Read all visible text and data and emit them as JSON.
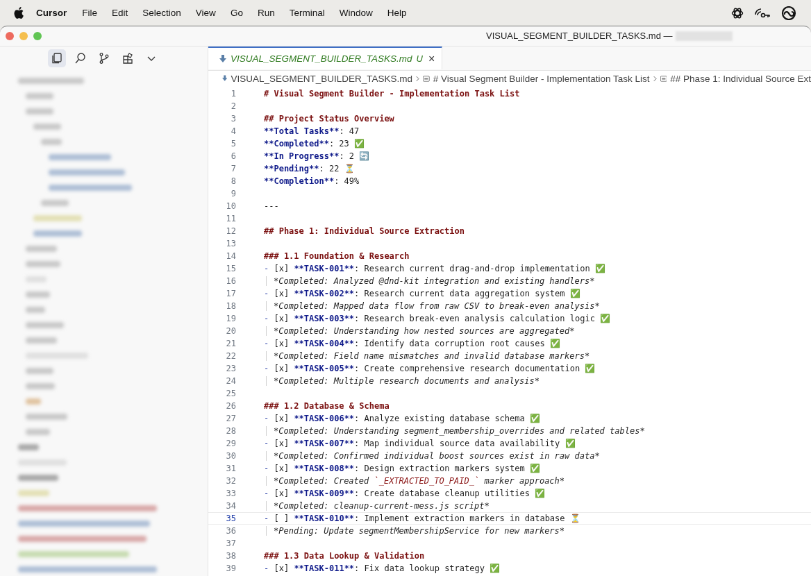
{
  "menu_bar": {
    "app": "Cursor",
    "items": [
      "File",
      "Edit",
      "Selection",
      "View",
      "Go",
      "Run",
      "Terminal",
      "Window",
      "Help"
    ]
  },
  "window": {
    "title": "VISUAL_SEGMENT_BUILDER_TASKS.md —"
  },
  "activity_bar": [
    {
      "selected": true
    },
    {
      "selected": false
    },
    {
      "selected": false
    },
    {
      "selected": false
    },
    {
      "selected": false
    }
  ],
  "tab": {
    "label": "VISUAL_SEGMENT_BUILDER_TASKS.md",
    "status": "U",
    "close": "×"
  },
  "breadcrumbs": [
    "VISUAL_SEGMENT_BUILDER_TASKS.md",
    "# Visual Segment Builder - Implementation Task List",
    "## Phase 1: Individual Source Ext"
  ],
  "lines": [
    {
      "n": "1",
      "current": false,
      "kind": "h",
      "text": "# Visual Segment Builder - Implementation Task List"
    },
    {
      "n": "2",
      "current": false,
      "kind": "blank"
    },
    {
      "n": "3",
      "current": false,
      "kind": "h",
      "text": "## Project Status Overview"
    },
    {
      "n": "4",
      "current": false,
      "kind": "field",
      "label": "**Total Tasks**",
      "value": ": 47"
    },
    {
      "n": "5",
      "current": false,
      "kind": "field",
      "label": "**Completed**",
      "value": ": 23",
      "emoji": "✅"
    },
    {
      "n": "6",
      "current": false,
      "kind": "field",
      "label": "**In Progress**",
      "value": ": 2",
      "emoji": "🔄"
    },
    {
      "n": "7",
      "current": false,
      "kind": "field",
      "label": "**Pending**",
      "value": ": 22",
      "emoji": "⏳"
    },
    {
      "n": "8",
      "current": false,
      "kind": "field",
      "label": "**Completion**",
      "value": ": 49%"
    },
    {
      "n": "9",
      "current": false,
      "kind": "blank"
    },
    {
      "n": "10",
      "current": false,
      "kind": "plain",
      "text": "---"
    },
    {
      "n": "11",
      "current": false,
      "kind": "blank"
    },
    {
      "n": "12",
      "current": false,
      "kind": "h",
      "text": "## Phase 1: Individual Source Extraction"
    },
    {
      "n": "13",
      "current": false,
      "kind": "blank"
    },
    {
      "n": "14",
      "current": false,
      "kind": "h",
      "text": "### 1.1 Foundation & Research"
    },
    {
      "n": "15",
      "current": false,
      "kind": "task",
      "bullet": "-",
      "box": "[x]",
      "id": "**TASK-001**",
      "text": ": Research current drag-and-drop implementation",
      "emoji": "✅"
    },
    {
      "n": "16",
      "current": false,
      "kind": "note",
      "parts": [
        {
          "t": "*Completed: Analyzed @dnd-kit integration and existing handlers*"
        }
      ]
    },
    {
      "n": "17",
      "current": false,
      "kind": "task",
      "bullet": "-",
      "box": "[x]",
      "id": "**TASK-002**",
      "text": ": Research current data aggregation system",
      "emoji": "✅"
    },
    {
      "n": "18",
      "current": false,
      "kind": "note",
      "parts": [
        {
          "t": "*Completed: Mapped data flow from raw CSV to break-even analysis*"
        }
      ]
    },
    {
      "n": "19",
      "current": false,
      "kind": "task",
      "bullet": "-",
      "box": "[x]",
      "id": "**TASK-003**",
      "text": ": Research break-even analysis calculation logic",
      "emoji": "✅"
    },
    {
      "n": "20",
      "current": false,
      "kind": "note",
      "parts": [
        {
          "t": "*Completed: Understanding how nested sources are aggregated*"
        }
      ]
    },
    {
      "n": "21",
      "current": false,
      "kind": "task",
      "bullet": "-",
      "box": "[x]",
      "id": "**TASK-004**",
      "text": ": Identify data corruption root causes",
      "emoji": "✅"
    },
    {
      "n": "22",
      "current": false,
      "kind": "note",
      "parts": [
        {
          "t": "*Completed: Field name mismatches and invalid database markers*"
        }
      ]
    },
    {
      "n": "23",
      "current": false,
      "kind": "task",
      "bullet": "-",
      "box": "[x]",
      "id": "**TASK-005**",
      "text": ": Create comprehensive research documentation",
      "emoji": "✅"
    },
    {
      "n": "24",
      "current": false,
      "kind": "note",
      "parts": [
        {
          "t": "*Completed: Multiple research documents and analysis*"
        }
      ]
    },
    {
      "n": "25",
      "current": false,
      "kind": "blank"
    },
    {
      "n": "26",
      "current": false,
      "kind": "h",
      "text": "### 1.2 Database & Schema"
    },
    {
      "n": "27",
      "current": false,
      "kind": "task",
      "bullet": "-",
      "box": "[x]",
      "id": "**TASK-006**",
      "text": ": Analyze existing database schema",
      "emoji": "✅"
    },
    {
      "n": "28",
      "current": false,
      "kind": "note",
      "parts": [
        {
          "t": "*Completed: Understanding segment_membership_overrides and related tables*"
        }
      ]
    },
    {
      "n": "29",
      "current": false,
      "kind": "task",
      "bullet": "-",
      "box": "[x]",
      "id": "**TASK-007**",
      "text": ": Map individual source data availability",
      "emoji": "✅"
    },
    {
      "n": "30",
      "current": false,
      "kind": "note",
      "parts": [
        {
          "t": "*Completed: Confirmed individual boost sources exist in raw data*"
        }
      ]
    },
    {
      "n": "31",
      "current": false,
      "kind": "task",
      "bullet": "-",
      "box": "[x]",
      "id": "**TASK-008**",
      "text": ": Design extraction markers system",
      "emoji": "✅"
    },
    {
      "n": "32",
      "current": false,
      "kind": "note",
      "parts": [
        {
          "t": "*Completed: Created "
        },
        {
          "code": "`_EXTRACTED_TO_PAID_`"
        },
        {
          "t": " marker approach*"
        }
      ]
    },
    {
      "n": "33",
      "current": false,
      "kind": "task",
      "bullet": "-",
      "box": "[x]",
      "id": "**TASK-009**",
      "text": ": Create database cleanup utilities",
      "emoji": "✅"
    },
    {
      "n": "34",
      "current": false,
      "kind": "note",
      "parts": [
        {
          "t": "*Completed: cleanup-current-mess.js script*"
        }
      ]
    },
    {
      "n": "35",
      "current": true,
      "kind": "task",
      "bullet": "-",
      "box": "[ ]",
      "id": "**TASK-010**",
      "text": ": Implement extraction markers in database",
      "emoji": "⏳"
    },
    {
      "n": "36",
      "current": false,
      "kind": "note",
      "parts": [
        {
          "t": "*Pending: Update segmentMembershipService for new markers*"
        }
      ]
    },
    {
      "n": "37",
      "current": false,
      "kind": "blank"
    },
    {
      "n": "38",
      "current": false,
      "kind": "h",
      "text": "### 1.3 Data Lookup & Validation"
    },
    {
      "n": "39",
      "current": false,
      "kind": "task",
      "bullet": "-",
      "box": "[x]",
      "id": "**TASK-011**",
      "text": ": Fix data lookup strategy",
      "emoji": "✅"
    }
  ]
}
